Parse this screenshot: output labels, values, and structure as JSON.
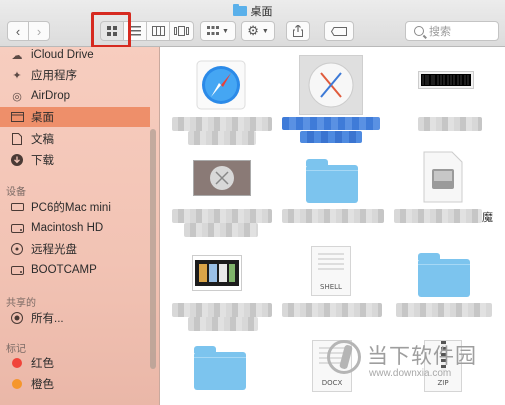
{
  "window": {
    "title": "桌面"
  },
  "toolbar": {
    "search_placeholder": "搜索"
  },
  "sidebar": {
    "favorites": [
      {
        "label": "iCloud Drive",
        "icon": "cloud-icon"
      },
      {
        "label": "应用程序",
        "icon": "applications-icon"
      },
      {
        "label": "AirDrop",
        "icon": "airdrop-icon"
      },
      {
        "label": "桌面",
        "icon": "desktop-icon",
        "selected": true
      },
      {
        "label": "文稿",
        "icon": "document-icon"
      },
      {
        "label": "下载",
        "icon": "download-icon"
      }
    ],
    "devices_header": "设备",
    "devices": [
      {
        "label": "PC6的Mac mini",
        "icon": "computer-icon"
      },
      {
        "label": "Macintosh HD",
        "icon": "disk-icon"
      },
      {
        "label": "远程光盘",
        "icon": "remote-disc-icon"
      },
      {
        "label": "BOOTCAMP",
        "icon": "disk-icon"
      }
    ],
    "shared_header": "共享的",
    "shared": [
      {
        "label": "所有...",
        "icon": "network-icon"
      }
    ],
    "tags_header": "标记",
    "tags": [
      {
        "label": "红色",
        "color": "#f0443a"
      },
      {
        "label": "橙色",
        "color": "#f5962c"
      }
    ]
  },
  "content": {
    "file_badges": {
      "shell": "SHELL",
      "docx": "DOCX",
      "zip": "ZIP",
      "partial_char": "魔"
    }
  },
  "watermark": {
    "brand": "当下软件园",
    "url": "www.downxia.com"
  },
  "colors": {
    "sidebar_selected": "#ee8f6a",
    "highlight_box": "#d62a20",
    "folder_blue": "#7cc4ee"
  }
}
